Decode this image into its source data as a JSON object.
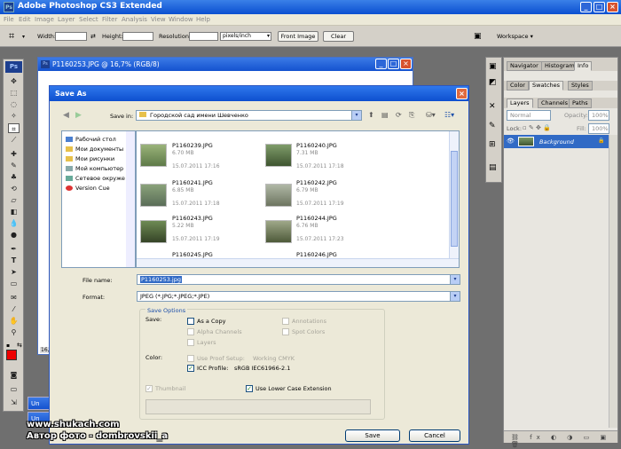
{
  "app": {
    "title": "Adobe Photoshop CS3 Extended",
    "ps_badge": "Ps"
  },
  "menu": [
    "File",
    "Edit",
    "Image",
    "Layer",
    "Select",
    "Filter",
    "Analysis",
    "View",
    "Window",
    "Help"
  ],
  "options_bar": {
    "width_label": "Width:",
    "height_label": "Height:",
    "resolution_label": "Resolution:",
    "units_value": "pixels/inch",
    "front_image_label": "Front Image",
    "clear_label": "Clear",
    "workspace_label": "Workspace"
  },
  "document": {
    "title": "P1160253.JPG @ 16,7% (RGB/8)",
    "zoom": "16,"
  },
  "dialog": {
    "title": "Save As",
    "save_in_label": "Save in:",
    "save_in_value": "Городской сад имени Шевченко",
    "places": [
      "Рабочий стол",
      "Мои документы",
      "Мои рисунки",
      "Мой компьютер",
      "Сетевое окруже",
      "Version Cue"
    ],
    "files": [
      {
        "name": "P1160239.JPG",
        "size": "6.70 MB",
        "date": "15.07.2011 17:16"
      },
      {
        "name": "P1160240.JPG",
        "size": "7.31 MB",
        "date": "15.07.2011 17:18"
      },
      {
        "name": "P1160241.JPG",
        "size": "6.85 MB",
        "date": "15.07.2011 17:18"
      },
      {
        "name": "P1160242.JPG",
        "size": "6.79 MB",
        "date": "15.07.2011 17:19"
      },
      {
        "name": "P1160243.JPG",
        "size": "5.22 MB",
        "date": "15.07.2011 17:19"
      },
      {
        "name": "P1160244.JPG",
        "size": "6.76 MB",
        "date": "15.07.2011 17:23"
      },
      {
        "name": "P1160245.JPG",
        "size": "",
        "date": ""
      },
      {
        "name": "P1160246.JPG",
        "size": "",
        "date": ""
      }
    ],
    "file_name_label": "File name:",
    "file_name_value": "P1160253.jpg",
    "format_label": "Format:",
    "format_value": "JPEG (*.JPG;*.JPEG;*.JPE)",
    "save_options_title": "Save Options",
    "save_label": "Save:",
    "as_copy": "As a Copy",
    "annotations": "Annotations",
    "alpha_channels": "Alpha Channels",
    "spot_colors": "Spot Colors",
    "layers": "Layers",
    "color_label": "Color:",
    "use_proof_setup": "Use Proof Setup:",
    "proof_value": "Working CMYK",
    "icc_profile": "ICC Profile:",
    "icc_value": "sRGB IEC61966-2.1",
    "thumbnail": "Thumbnail",
    "lower_case": "Use Lower Case Extension",
    "save_button": "Save",
    "cancel_button": "Cancel"
  },
  "panels": {
    "group1": [
      "Navigator",
      "Histogram",
      "Info"
    ],
    "group2": [
      "Color",
      "Swatches",
      "Styles"
    ],
    "group3": [
      "Layers",
      "Channels",
      "Paths"
    ],
    "blend_mode": "Normal",
    "opacity_label": "Opacity:",
    "opacity_value": "100%",
    "lock_label": "Lock:",
    "fill_label": "Fill:",
    "fill_value": "100%",
    "layer_name": "Background"
  },
  "taskbar": {
    "tab1": "Un",
    "tab2": "Un"
  },
  "watermark": {
    "line1": "www.shukach.com",
    "line2": "Автор фото - dombrovskii_a"
  }
}
